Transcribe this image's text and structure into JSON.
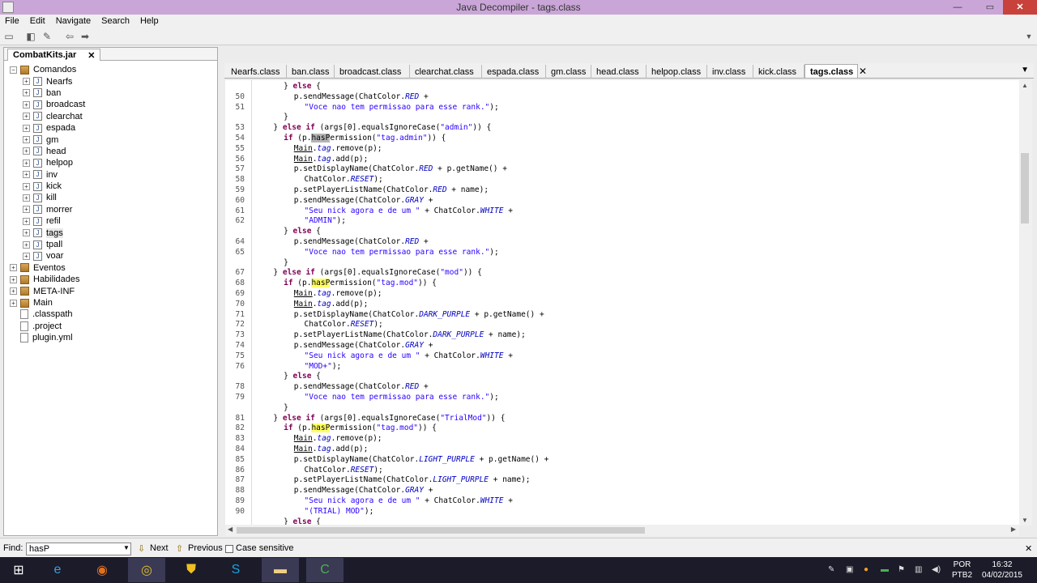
{
  "window": {
    "title": "Java Decompiler - tags.class",
    "controls": {
      "minimize": "—",
      "maximize": "▭",
      "close": "✕"
    }
  },
  "menu": [
    "File",
    "Edit",
    "Navigate",
    "Search",
    "Help"
  ],
  "toolbar": {
    "buttons": [
      "open-folder-icon",
      "open-file-icon",
      "refresh-icon",
      "back-icon",
      "forward-icon"
    ]
  },
  "left_panel": {
    "tab_label": "CombatKits.jar",
    "tab_close": "✕",
    "tree": [
      {
        "label": "Comandos",
        "type": "package",
        "expanded": true,
        "depth": 0
      },
      {
        "label": "Nearfs",
        "type": "class",
        "depth": 1
      },
      {
        "label": "ban",
        "type": "class",
        "depth": 1
      },
      {
        "label": "broadcast",
        "type": "class",
        "depth": 1
      },
      {
        "label": "clearchat",
        "type": "class",
        "depth": 1
      },
      {
        "label": "espada",
        "type": "class",
        "depth": 1
      },
      {
        "label": "gm",
        "type": "class",
        "depth": 1
      },
      {
        "label": "head",
        "type": "class",
        "depth": 1
      },
      {
        "label": "helpop",
        "type": "class",
        "depth": 1
      },
      {
        "label": "inv",
        "type": "class",
        "depth": 1
      },
      {
        "label": "kick",
        "type": "class",
        "depth": 1
      },
      {
        "label": "kill",
        "type": "class",
        "depth": 1
      },
      {
        "label": "morrer",
        "type": "class",
        "depth": 1
      },
      {
        "label": "refil",
        "type": "class",
        "depth": 1
      },
      {
        "label": "tags",
        "type": "class",
        "depth": 1,
        "selected": true
      },
      {
        "label": "tpall",
        "type": "class",
        "depth": 1
      },
      {
        "label": "voar",
        "type": "class",
        "depth": 1
      },
      {
        "label": "Eventos",
        "type": "package",
        "depth": 0
      },
      {
        "label": "Habilidades",
        "type": "package",
        "depth": 0
      },
      {
        "label": "META-INF",
        "type": "package",
        "depth": 0
      },
      {
        "label": "Main",
        "type": "package",
        "depth": 0
      },
      {
        "label": ".classpath",
        "type": "file",
        "depth": 0
      },
      {
        "label": ".project",
        "type": "file",
        "depth": 0
      },
      {
        "label": "plugin.yml",
        "type": "file",
        "depth": 0
      }
    ]
  },
  "editor": {
    "tabs": [
      {
        "label": "Nearfs.class"
      },
      {
        "label": "ban.class"
      },
      {
        "label": "broadcast.class"
      },
      {
        "label": "clearchat.class"
      },
      {
        "label": "espada.class"
      },
      {
        "label": "gm.class"
      },
      {
        "label": "head.class"
      },
      {
        "label": "helpop.class"
      },
      {
        "label": "inv.class"
      },
      {
        "label": "kick.class"
      },
      {
        "label": "tags.class",
        "active": true
      }
    ],
    "tab_close": "✕",
    "lines": [
      {
        "n": "",
        "indent": 6,
        "tokens": [
          [
            "} ",
            ""
          ],
          [
            "else",
            "kw"
          ],
          [
            " {",
            ""
          ]
        ]
      },
      {
        "n": "50",
        "indent": 8,
        "tokens": [
          [
            "p.sendMessage(ChatColor.",
            ""
          ],
          [
            "RED",
            "it"
          ],
          [
            " +",
            ""
          ]
        ]
      },
      {
        "n": "51",
        "indent": 10,
        "tokens": [
          [
            "\"Voce nao tem permissao para esse rank.\"",
            "str"
          ],
          [
            ");",
            ""
          ]
        ]
      },
      {
        "n": "",
        "indent": 6,
        "tokens": [
          [
            "}",
            ""
          ]
        ]
      },
      {
        "n": "53",
        "indent": 4,
        "tokens": [
          [
            "} ",
            ""
          ],
          [
            "else if",
            "kw"
          ],
          [
            " (args[0].equalsIgnoreCase(",
            ""
          ],
          [
            "\"admin\"",
            "str"
          ],
          [
            ")) {",
            ""
          ]
        ]
      },
      {
        "n": "54",
        "indent": 6,
        "tokens": [
          [
            "if",
            "kw"
          ],
          [
            " (p.",
            ""
          ],
          [
            "hasP",
            "hlsel"
          ],
          [
            "ermission(",
            ""
          ],
          [
            "\"tag.admin\"",
            "str"
          ],
          [
            ")) {",
            ""
          ]
        ]
      },
      {
        "n": "55",
        "indent": 8,
        "tokens": [
          [
            "Main",
            "ul"
          ],
          [
            ".",
            ""
          ],
          [
            "tag",
            "it"
          ],
          [
            ".remove(p);",
            ""
          ]
        ]
      },
      {
        "n": "56",
        "indent": 8,
        "tokens": [
          [
            "Main",
            "ul"
          ],
          [
            ".",
            ""
          ],
          [
            "tag",
            "it"
          ],
          [
            ".add(p);",
            ""
          ]
        ]
      },
      {
        "n": "57",
        "indent": 8,
        "tokens": [
          [
            "p.setDisplayName(ChatColor.",
            ""
          ],
          [
            "RED",
            "it"
          ],
          [
            " + p.getName() +",
            ""
          ]
        ]
      },
      {
        "n": "58",
        "indent": 10,
        "tokens": [
          [
            "ChatColor.",
            ""
          ],
          [
            "RESET",
            "it"
          ],
          [
            ");",
            ""
          ]
        ]
      },
      {
        "n": "59",
        "indent": 8,
        "tokens": [
          [
            "p.setPlayerListName(ChatColor.",
            ""
          ],
          [
            "RED",
            "it"
          ],
          [
            " + name);",
            ""
          ]
        ]
      },
      {
        "n": "60",
        "indent": 8,
        "tokens": [
          [
            "p.sendMessage(ChatColor.",
            ""
          ],
          [
            "GRAY",
            "it"
          ],
          [
            " +",
            ""
          ]
        ]
      },
      {
        "n": "61",
        "indent": 10,
        "tokens": [
          [
            "\"Seu nick agora e de um \"",
            "str"
          ],
          [
            " + ChatColor.",
            ""
          ],
          [
            "WHITE",
            "it"
          ],
          [
            " +",
            ""
          ]
        ]
      },
      {
        "n": "62",
        "indent": 10,
        "tokens": [
          [
            "\"ADMIN\"",
            "str"
          ],
          [
            ");",
            ""
          ]
        ]
      },
      {
        "n": "",
        "indent": 6,
        "tokens": [
          [
            "} ",
            ""
          ],
          [
            "else",
            "kw"
          ],
          [
            " {",
            ""
          ]
        ]
      },
      {
        "n": "64",
        "indent": 8,
        "tokens": [
          [
            "p.sendMessage(ChatColor.",
            ""
          ],
          [
            "RED",
            "it"
          ],
          [
            " +",
            ""
          ]
        ]
      },
      {
        "n": "65",
        "indent": 10,
        "tokens": [
          [
            "\"Voce nao tem permissao para esse rank.\"",
            "str"
          ],
          [
            ");",
            ""
          ]
        ]
      },
      {
        "n": "",
        "indent": 6,
        "tokens": [
          [
            "}",
            ""
          ]
        ]
      },
      {
        "n": "67",
        "indent": 4,
        "tokens": [
          [
            "} ",
            ""
          ],
          [
            "else if",
            "kw"
          ],
          [
            " (args[0].equalsIgnoreCase(",
            ""
          ],
          [
            "\"mod\"",
            "str"
          ],
          [
            ")) {",
            ""
          ]
        ]
      },
      {
        "n": "68",
        "indent": 6,
        "tokens": [
          [
            "if",
            "kw"
          ],
          [
            " (p.",
            ""
          ],
          [
            "hasP",
            "hl"
          ],
          [
            "ermission(",
            ""
          ],
          [
            "\"tag.mod\"",
            "str"
          ],
          [
            ")) {",
            ""
          ]
        ]
      },
      {
        "n": "69",
        "indent": 8,
        "tokens": [
          [
            "Main",
            "ul"
          ],
          [
            ".",
            ""
          ],
          [
            "tag",
            "it"
          ],
          [
            ".remove(p);",
            ""
          ]
        ]
      },
      {
        "n": "70",
        "indent": 8,
        "tokens": [
          [
            "Main",
            "ul"
          ],
          [
            ".",
            ""
          ],
          [
            "tag",
            "it"
          ],
          [
            ".add(p);",
            ""
          ]
        ]
      },
      {
        "n": "71",
        "indent": 8,
        "tokens": [
          [
            "p.setDisplayName(ChatColor.",
            ""
          ],
          [
            "DARK_PURPLE",
            "it"
          ],
          [
            " + p.getName() +",
            ""
          ]
        ]
      },
      {
        "n": "72",
        "indent": 10,
        "tokens": [
          [
            "ChatColor.",
            ""
          ],
          [
            "RESET",
            "it"
          ],
          [
            ");",
            ""
          ]
        ]
      },
      {
        "n": "73",
        "indent": 8,
        "tokens": [
          [
            "p.setPlayerListName(ChatColor.",
            ""
          ],
          [
            "DARK_PURPLE",
            "it"
          ],
          [
            " + name);",
            ""
          ]
        ]
      },
      {
        "n": "74",
        "indent": 8,
        "tokens": [
          [
            "p.sendMessage(ChatColor.",
            ""
          ],
          [
            "GRAY",
            "it"
          ],
          [
            " +",
            ""
          ]
        ]
      },
      {
        "n": "75",
        "indent": 10,
        "tokens": [
          [
            "\"Seu nick agora e de um \"",
            "str"
          ],
          [
            " + ChatColor.",
            ""
          ],
          [
            "WHITE",
            "it"
          ],
          [
            " +",
            ""
          ]
        ]
      },
      {
        "n": "76",
        "indent": 10,
        "tokens": [
          [
            "\"MOD+\"",
            "str"
          ],
          [
            ");",
            ""
          ]
        ]
      },
      {
        "n": "",
        "indent": 6,
        "tokens": [
          [
            "} ",
            ""
          ],
          [
            "else",
            "kw"
          ],
          [
            " {",
            ""
          ]
        ]
      },
      {
        "n": "78",
        "indent": 8,
        "tokens": [
          [
            "p.sendMessage(ChatColor.",
            ""
          ],
          [
            "RED",
            "it"
          ],
          [
            " +",
            ""
          ]
        ]
      },
      {
        "n": "79",
        "indent": 10,
        "tokens": [
          [
            "\"Voce nao tem permissao para esse rank.\"",
            "str"
          ],
          [
            ");",
            ""
          ]
        ]
      },
      {
        "n": "",
        "indent": 6,
        "tokens": [
          [
            "}",
            ""
          ]
        ]
      },
      {
        "n": "81",
        "indent": 4,
        "tokens": [
          [
            "} ",
            ""
          ],
          [
            "else if",
            "kw"
          ],
          [
            " (args[0].equalsIgnoreCase(",
            ""
          ],
          [
            "\"TrialMod\"",
            "str"
          ],
          [
            ")) {",
            ""
          ]
        ]
      },
      {
        "n": "82",
        "indent": 6,
        "tokens": [
          [
            "if",
            "kw"
          ],
          [
            " (p.",
            ""
          ],
          [
            "hasP",
            "hl"
          ],
          [
            "ermission(",
            ""
          ],
          [
            "\"tag.mod\"",
            "str"
          ],
          [
            ")) {",
            ""
          ]
        ]
      },
      {
        "n": "83",
        "indent": 8,
        "tokens": [
          [
            "Main",
            "ul"
          ],
          [
            ".",
            ""
          ],
          [
            "tag",
            "it"
          ],
          [
            ".remove(p);",
            ""
          ]
        ]
      },
      {
        "n": "84",
        "indent": 8,
        "tokens": [
          [
            "Main",
            "ul"
          ],
          [
            ".",
            ""
          ],
          [
            "tag",
            "it"
          ],
          [
            ".add(p);",
            ""
          ]
        ]
      },
      {
        "n": "85",
        "indent": 8,
        "tokens": [
          [
            "p.setDisplayName(ChatColor.",
            ""
          ],
          [
            "LIGHT_PURPLE",
            "it"
          ],
          [
            " + p.getName() +",
            ""
          ]
        ]
      },
      {
        "n": "86",
        "indent": 10,
        "tokens": [
          [
            "ChatColor.",
            ""
          ],
          [
            "RESET",
            "it"
          ],
          [
            ");",
            ""
          ]
        ]
      },
      {
        "n": "87",
        "indent": 8,
        "tokens": [
          [
            "p.setPlayerListName(ChatColor.",
            ""
          ],
          [
            "LIGHT_PURPLE",
            "it"
          ],
          [
            " + name);",
            ""
          ]
        ]
      },
      {
        "n": "88",
        "indent": 8,
        "tokens": [
          [
            "p.sendMessage(ChatColor.",
            ""
          ],
          [
            "GRAY",
            "it"
          ],
          [
            " +",
            ""
          ]
        ]
      },
      {
        "n": "89",
        "indent": 10,
        "tokens": [
          [
            "\"Seu nick agora e de um \"",
            "str"
          ],
          [
            " + ChatColor.",
            ""
          ],
          [
            "WHITE",
            "it"
          ],
          [
            " +",
            ""
          ]
        ]
      },
      {
        "n": "90",
        "indent": 10,
        "tokens": [
          [
            "\"(TRIAL) MOD\"",
            "str"
          ],
          [
            ");",
            ""
          ]
        ]
      },
      {
        "n": "",
        "indent": 6,
        "tokens": [
          [
            "} ",
            ""
          ],
          [
            "else",
            "kw"
          ],
          [
            " {",
            ""
          ]
        ]
      }
    ]
  },
  "findbar": {
    "label": "Find:",
    "value": "hasP",
    "next_label": "Next",
    "previous_label": "Previous",
    "case_sensitive_label": "Case sensitive",
    "close": "✕"
  },
  "taskbar": {
    "apps": [
      "windows-start-icon",
      "internet-explorer-icon",
      "firefox-icon",
      "chrome-icon",
      "security-shield-icon",
      "skype-icon",
      "file-explorer-icon",
      "java-decompiler-icon"
    ],
    "language": "POR",
    "layout": "PTB2",
    "time": "16:32",
    "date": "04/02/2015"
  },
  "colors": {
    "title_bar": "#c9a6d7",
    "keyword": "#7f0055",
    "string": "#2a00ff",
    "field_italic": "#0000c0",
    "search_highlight": "#ffff66",
    "taskbar": "#1b1b2a"
  }
}
